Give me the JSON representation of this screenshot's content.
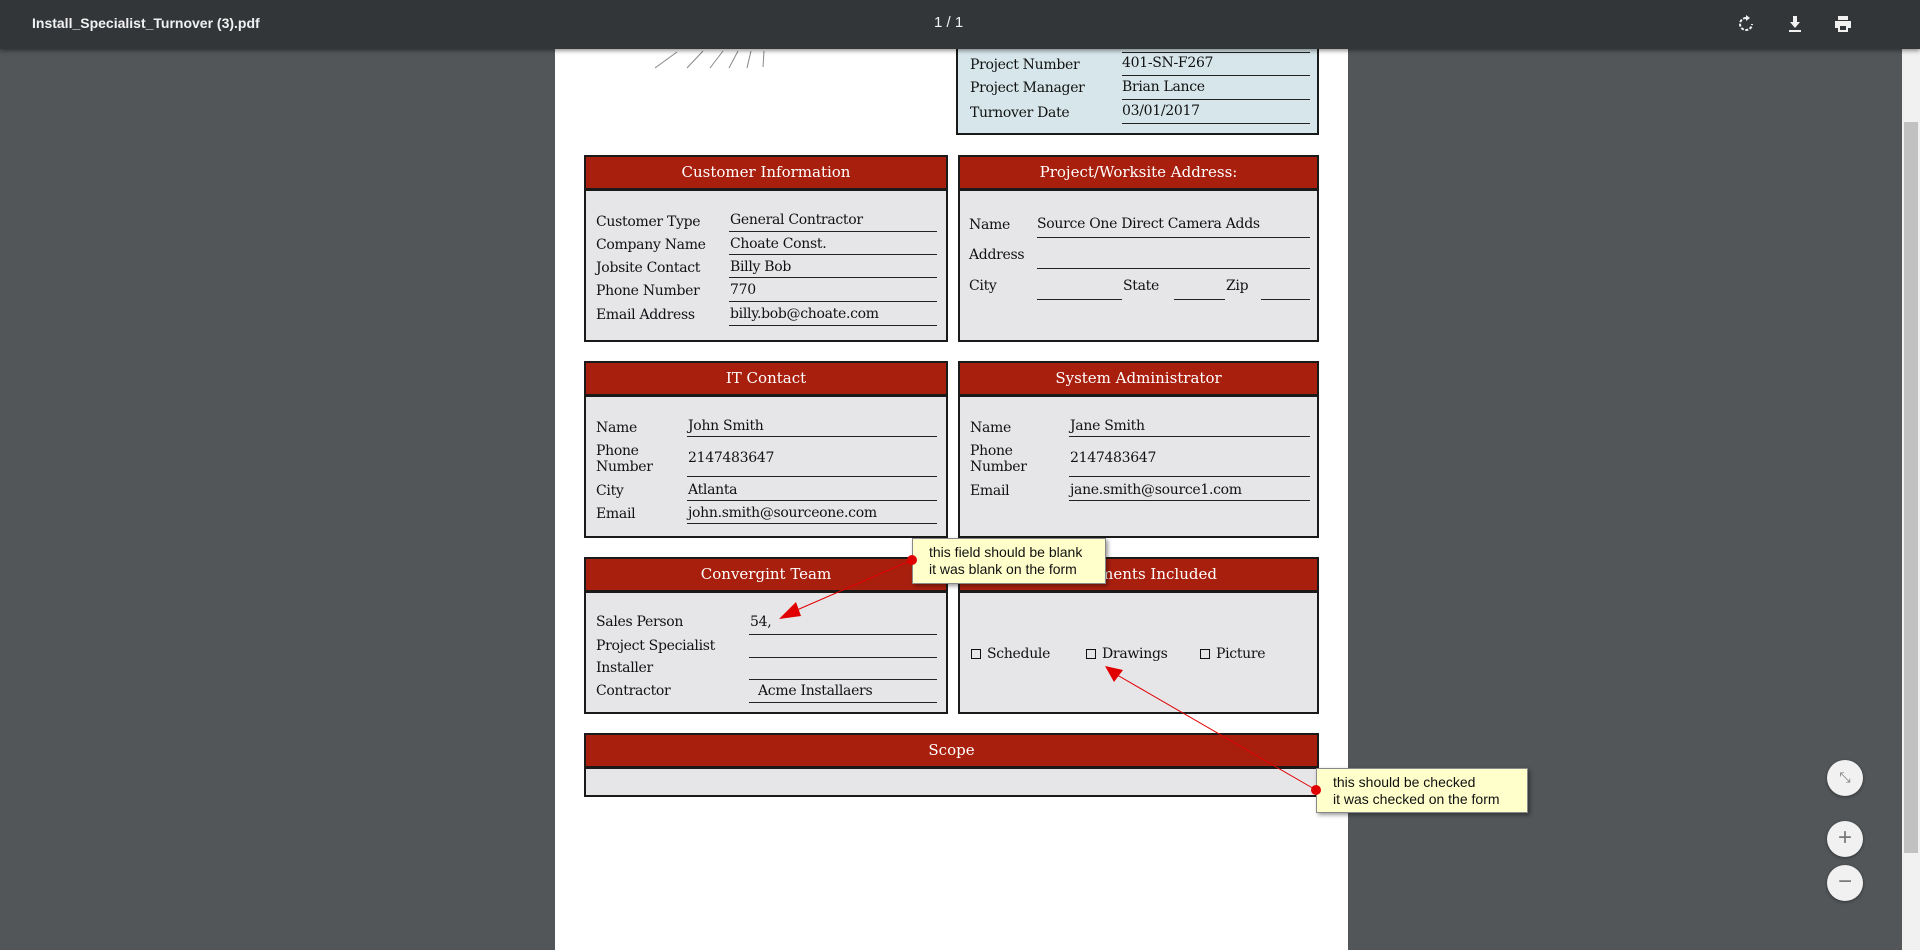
{
  "viewer": {
    "filename": "Install_Specialist_Turnover (3).pdf",
    "page_current": "1",
    "page_sep": "/",
    "page_total": "1"
  },
  "project": {
    "rows": [
      {
        "label": "Project Number",
        "value": "401-SN-F267"
      },
      {
        "label": "Project Manager",
        "value": "Brian Lance"
      },
      {
        "label": "Turnover Date",
        "value": "03/01/2017"
      }
    ]
  },
  "customer": {
    "title": "Customer Information",
    "rows": [
      {
        "label": "Customer Type",
        "value": "General Contractor"
      },
      {
        "label": "Company Name",
        "value": "Choate Const."
      },
      {
        "label": "Jobsite Contact",
        "value": "Billy Bob"
      },
      {
        "label": "Phone Number",
        "value": "770"
      },
      {
        "label": "Email Address",
        "value": "billy.bob@choate.com"
      }
    ]
  },
  "worksite": {
    "title": "Project/Worksite Address:",
    "name_label": "Name",
    "name_value": "Source One Direct Camera Adds",
    "address_label": "Address",
    "city_label": "City",
    "state_label": "State",
    "zip_label": "Zip"
  },
  "it": {
    "title": "IT Contact",
    "name_label": "Name",
    "name": "John Smith",
    "phone_label1": "Phone",
    "phone_label2": "Number",
    "phone": "2147483647",
    "city_label": "City",
    "city": "Atlanta",
    "email_label": "Email",
    "email": "john.smith@sourceone.com"
  },
  "sysadmin": {
    "title": "System Administrator",
    "name_label": "Name",
    "name": "Jane Smith",
    "phone_label1": "Phone",
    "phone_label2": "Number",
    "phone": "2147483647",
    "email_label": "Email",
    "email": "jane.smith@source1.com"
  },
  "team": {
    "title": "Convergint Team",
    "sales_label": "Sales Person",
    "sales": "54,",
    "ps_label": "Project Specialist",
    "installer_label": "Installer",
    "contractor_label": "Contractor",
    "contractor": "Acme Installaers"
  },
  "docs": {
    "title": "Documents Included",
    "items": [
      "Schedule",
      "Drawings",
      "Picture"
    ]
  },
  "scope": {
    "title": "Scope"
  },
  "notes": [
    {
      "line1": "this field should be blank",
      "line2": "it was blank on the form"
    },
    {
      "line1": "this should be checked",
      "line2": "it was checked on the form"
    }
  ],
  "colors": {
    "header": "#a91f0e",
    "box": "#e6e5e8",
    "project_box": "#d6e6ea",
    "note": "#ffffcc",
    "arrow": "#e00000"
  }
}
